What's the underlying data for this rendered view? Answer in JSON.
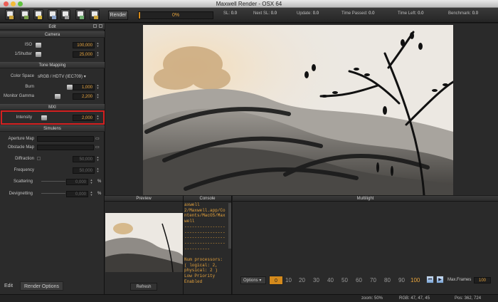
{
  "window": {
    "title": "Maxwell Render -  OSX 64"
  },
  "toolbar": {
    "icons": [
      "open-mxs-icon",
      "save-mxs-icon",
      "save-mxi-icon",
      "render-scene-icon",
      "batch-render-icon",
      "save-image-icon",
      "network-icon"
    ],
    "render_label": "Render",
    "progress_text": "0%",
    "progress_value": 0.02,
    "stats": [
      {
        "label": "SL:",
        "value": "0.0"
      },
      {
        "label": "Next SL:",
        "value": "0.0"
      },
      {
        "label": "Update:",
        "value": "0.0"
      },
      {
        "label": "Time Passed:",
        "value": "0.0"
      },
      {
        "label": "Time Left:",
        "value": "0.0"
      },
      {
        "label": "Benchmark:",
        "value": "0.0"
      }
    ]
  },
  "left_panel": {
    "header": "Edit",
    "camera": {
      "title": "Camera",
      "iso_label": "ISO",
      "iso_value": "100,000",
      "shutter_label": "1/Shutter",
      "shutter_value": "25,000"
    },
    "tone": {
      "title": "Tone Mapping",
      "color_space_label": "Color Space",
      "color_space_value": "sRGB / HDTV (IEC709)",
      "burn_label": "Burn",
      "burn_value": "1,000",
      "gamma_label": "Monitor Gamma",
      "gamma_value": "2,200"
    },
    "mxi": {
      "title": "MXI",
      "intensity_label": "Intensity",
      "intensity_value": "2,000"
    },
    "simulens": {
      "title": "Simulens",
      "aperture_label": "Aperture Map",
      "obstacle_label": "Obstacle Map",
      "diffraction_label": "Diffraction",
      "diffraction_value": "50,000",
      "frequency_label": "Frequency",
      "frequency_value": "50,000",
      "scattering_label": "Scattering",
      "scattering_value": "0,000",
      "devignetting_label": "Devignetting",
      "devignetting_value": "0,000",
      "percent": "%"
    },
    "tabs": [
      "Edit",
      "Render Options"
    ]
  },
  "preview": {
    "title": "Preview",
    "refresh_label": "Refresh"
  },
  "console": {
    "title": "Console",
    "lines": [
      "axwell",
      "2/Maxwell.app/Co",
      "ntents/MacOS/Max",
      "well",
      "----------------",
      "----------------",
      "----------------",
      "----------------",
      "----------",
      "",
      "Num processors:",
      "( logical: 2,",
      "physical: 2 )",
      "Low Priority",
      "Enabled"
    ]
  },
  "multilight": {
    "title": "Multilight",
    "options_label": "Options",
    "zero_label": "0",
    "values": [
      "10",
      "20",
      "30",
      "40",
      "50",
      "60",
      "70",
      "80",
      "90",
      "100"
    ],
    "maxframes_label": "Max.Frames",
    "maxframes_value": "100"
  },
  "status": {
    "zoom": "zoom: 50%",
    "rgb": "RGB: 47, 47, 45",
    "pos": "Pos: 362, 724"
  },
  "colors": {
    "accent": "#e8a43c",
    "progress": "#d48a1c",
    "highlight": "#d42020"
  }
}
